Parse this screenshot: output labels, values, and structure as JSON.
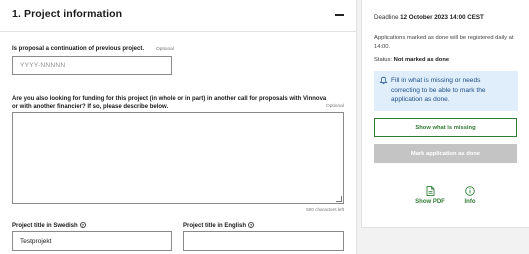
{
  "section": {
    "title": "1. Project information",
    "collapse_label": "−"
  },
  "continuation": {
    "label": "Is proposal a continuation of previous project.",
    "optional": "Optional",
    "placeholder": "YYYY-NNNNN",
    "value": ""
  },
  "other_funding": {
    "label": "Are you also looking for funding for this project (in whole or in part) in another call for proposals with Vinnova or with another financier? If so, please describe below.",
    "optional": "Optional",
    "char_count": "500 characters left"
  },
  "title_swedish": {
    "label": "Project title in Swedish",
    "value": "Testprojekt"
  },
  "title_english": {
    "label": "Project title in English",
    "value": ""
  },
  "sidebar": {
    "deadline_prefix": "Deadline",
    "deadline_value": "12 October 2023 14:00 CEST",
    "info_text": "Applications marked as done will be registered daily at 14:00.",
    "status_prefix": "Status:",
    "status_value": "Not marked as done",
    "notice": "Fill in what is missing or needs correcting to be able to mark the application as done.",
    "show_missing_label": "Show what is missing",
    "mark_done_label": "Mark application as done",
    "show_pdf_label": "Show PDF",
    "info_label": "Info"
  },
  "colors": {
    "accent_green": "#2e7d32",
    "notice_bg": "#dfeefa",
    "notice_text": "#1d4e8a",
    "disabled_button": "#c4c4c4"
  },
  "icons": [
    "collapse-icon",
    "info-icon",
    "bell-icon",
    "pdf-icon",
    "info-circle-icon"
  ]
}
